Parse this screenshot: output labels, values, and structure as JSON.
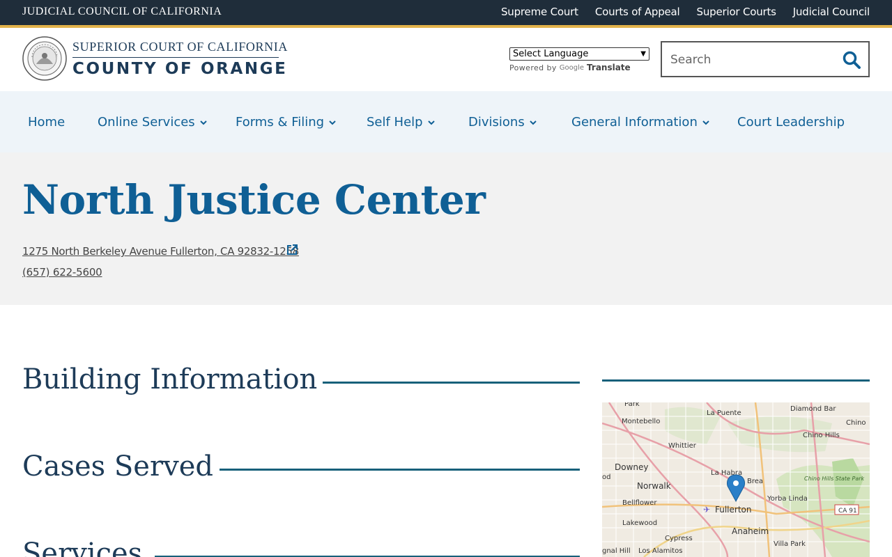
{
  "topbar": {
    "title": "Judicial Council of California",
    "links": [
      "Supreme Court",
      "Courts of Appeal",
      "Superior Courts",
      "Judicial Council"
    ]
  },
  "header": {
    "logo_line1": "Superior Court of California",
    "logo_line2": "County of Orange",
    "seal_icon": "court-seal-icon",
    "language_select": {
      "selected": "Select Language"
    },
    "powered_by": "Powered by",
    "google": "Google",
    "translate": "Translate",
    "search": {
      "placeholder": "Search",
      "value": "",
      "icon": "search-icon"
    }
  },
  "nav": {
    "items": [
      {
        "label": "Home",
        "has_dropdown": false
      },
      {
        "label": "Online Services",
        "has_dropdown": true
      },
      {
        "label": "Forms & Filing",
        "has_dropdown": true
      },
      {
        "label": "Self Help",
        "has_dropdown": true
      },
      {
        "label": "Divisions",
        "has_dropdown": true
      },
      {
        "label": "General Information",
        "has_dropdown": true
      },
      {
        "label": "Court Leadership",
        "has_dropdown": false
      }
    ]
  },
  "hero": {
    "title": "North Justice Center",
    "address": "1275 North Berkeley Avenue Fullerton, CA 92832-1258",
    "phone": "(657) 622-5600"
  },
  "sections": [
    "Building Information",
    "Cases Served",
    "Services"
  ],
  "map": {
    "labels": [
      "Park",
      "Montebello",
      "La Puente",
      "Diamond Bar",
      "Chino",
      "Chino Hills",
      "Whittier",
      "Downey",
      "La Habra",
      "Brea",
      "Norwalk",
      "Chino Hills State Park",
      "Bellflower",
      "Yorba Linda",
      "Fullerton",
      "CA 91",
      "Lakewood",
      "Anaheim",
      "Cypress",
      "Villa Park",
      "Los Alamitos",
      "gnal Hill",
      "od"
    ]
  },
  "colors": {
    "topbar": "#1f2d3a",
    "accent": "#e2b24a",
    "link_blue": "#0f5f95",
    "heading_navy": "#1d3b58",
    "rule_teal": "#17607a",
    "nav_bg": "#eef4f9",
    "hero_bg": "#f2f2f2"
  }
}
